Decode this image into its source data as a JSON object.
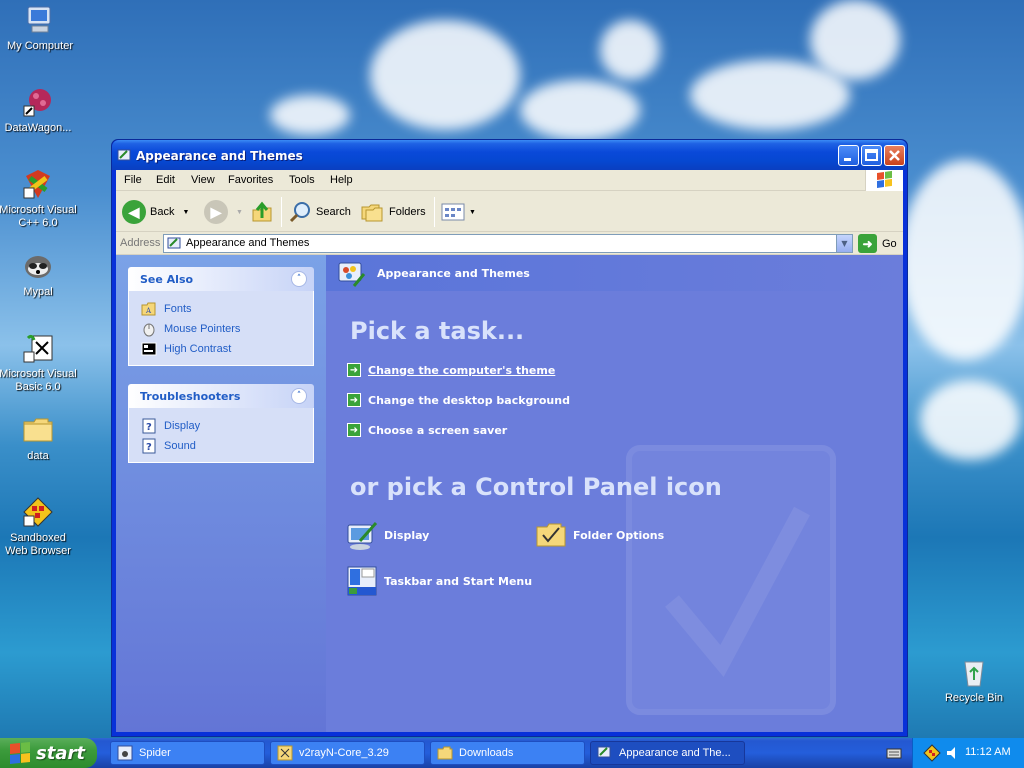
{
  "desktop": {
    "icons": [
      {
        "label": "My Computer"
      },
      {
        "label": "DataWagon..."
      },
      {
        "label": "Microsoft Visual C++ 6.0"
      },
      {
        "label": "Mypal"
      },
      {
        "label": "Microsoft Visual Basic 6.0"
      },
      {
        "label": "data"
      },
      {
        "label": "Sandboxed Web Browser"
      },
      {
        "label": "Recycle Bin"
      }
    ]
  },
  "window": {
    "title": "Appearance and Themes",
    "menu": [
      "File",
      "Edit",
      "View",
      "Favorites",
      "Tools",
      "Help"
    ],
    "toolbar": {
      "back": "Back",
      "search": "Search",
      "folders": "Folders"
    },
    "address": {
      "label": "Address",
      "value": "Appearance and Themes",
      "go": "Go"
    },
    "sidebar": {
      "see_also": {
        "title": "See Also",
        "links": [
          "Fonts",
          "Mouse Pointers",
          "High Contrast"
        ]
      },
      "troubleshooters": {
        "title": "Troubleshooters",
        "links": [
          "Display",
          "Sound"
        ]
      }
    },
    "main": {
      "header": "Appearance and Themes",
      "pick_task": "Pick a task...",
      "tasks": [
        "Change the computer's theme",
        "Change the desktop background",
        "Choose a screen saver"
      ],
      "pick_icon": "or pick a Control Panel icon",
      "icons": [
        "Display",
        "Folder Options",
        "Taskbar and Start Menu"
      ]
    }
  },
  "taskbar": {
    "start": "start",
    "buttons": [
      "Spider",
      "v2rayN-Core_3.29",
      "Downloads",
      "Appearance and The..."
    ],
    "clock": "11:12 AM"
  }
}
